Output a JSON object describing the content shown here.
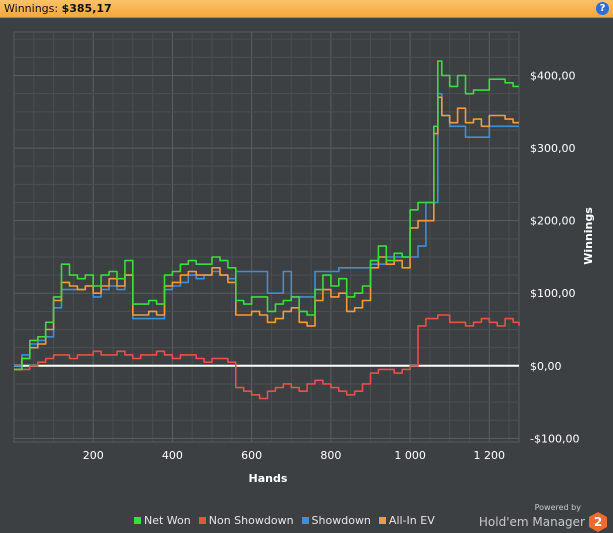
{
  "header": {
    "title_label": "Winnings:",
    "title_value": "$385,17",
    "help_icon": "?"
  },
  "branding": {
    "powered_by": "Powered by",
    "product": "Hold'em Manager",
    "logo_mark": "2"
  },
  "chart_data": {
    "type": "line",
    "xlabel": "Hands",
    "ylabel": "Winnings",
    "xlim": [
      0,
      1275
    ],
    "ylim": [
      -105,
      460
    ],
    "x_ticks": [
      200,
      400,
      600,
      800,
      1000,
      1200
    ],
    "x_tick_labels": [
      "200",
      "400",
      "600",
      "800",
      "1 000",
      "1 200"
    ],
    "y_ticks": [
      -100,
      0,
      100,
      200,
      300,
      400
    ],
    "y_tick_labels": [
      "-$100,00",
      "$0,00",
      "$100,00",
      "$200,00",
      "$300,00",
      "$400,00"
    ],
    "grid": true,
    "legend_position": "bottom",
    "series": [
      {
        "name": "Net Won",
        "color": "#3ddc3d",
        "x": [
          0,
          20,
          40,
          60,
          80,
          100,
          120,
          140,
          160,
          180,
          200,
          220,
          240,
          260,
          280,
          300,
          320,
          340,
          360,
          380,
          400,
          420,
          440,
          460,
          480,
          500,
          520,
          540,
          560,
          580,
          600,
          620,
          640,
          660,
          680,
          700,
          720,
          740,
          760,
          780,
          800,
          820,
          840,
          860,
          880,
          900,
          920,
          940,
          960,
          980,
          1000,
          1020,
          1040,
          1060,
          1070,
          1080,
          1100,
          1120,
          1140,
          1160,
          1180,
          1200,
          1220,
          1240,
          1260,
          1275
        ],
        "y": [
          -5,
          10,
          35,
          40,
          60,
          95,
          140,
          125,
          120,
          125,
          110,
          125,
          130,
          120,
          145,
          85,
          85,
          90,
          85,
          125,
          130,
          140,
          145,
          140,
          140,
          150,
          145,
          135,
          90,
          85,
          95,
          95,
          75,
          85,
          90,
          95,
          75,
          70,
          105,
          125,
          110,
          120,
          95,
          100,
          110,
          145,
          165,
          145,
          155,
          150,
          215,
          225,
          225,
          330,
          420,
          400,
          385,
          400,
          375,
          380,
          380,
          395,
          395,
          390,
          385,
          385
        ]
      },
      {
        "name": "Non Showdown",
        "color": "#e8504a",
        "x": [
          0,
          20,
          40,
          60,
          80,
          100,
          120,
          140,
          160,
          180,
          200,
          220,
          240,
          260,
          280,
          300,
          320,
          340,
          360,
          380,
          400,
          420,
          440,
          460,
          480,
          500,
          520,
          540,
          560,
          580,
          600,
          620,
          640,
          660,
          680,
          700,
          720,
          740,
          760,
          780,
          800,
          820,
          840,
          860,
          880,
          900,
          920,
          940,
          960,
          980,
          1000,
          1020,
          1040,
          1060,
          1070,
          1080,
          1100,
          1120,
          1140,
          1160,
          1180,
          1200,
          1220,
          1240,
          1260,
          1275
        ],
        "y": [
          -5,
          -5,
          0,
          5,
          10,
          15,
          15,
          10,
          15,
          15,
          20,
          15,
          15,
          20,
          15,
          10,
          15,
          15,
          20,
          15,
          10,
          15,
          15,
          10,
          5,
          10,
          10,
          5,
          -30,
          -35,
          -40,
          -45,
          -35,
          -30,
          -25,
          -30,
          -35,
          -25,
          -20,
          -25,
          -30,
          -35,
          -40,
          -35,
          -25,
          -10,
          -5,
          -5,
          -10,
          -5,
          0,
          55,
          65,
          65,
          70,
          70,
          60,
          60,
          55,
          60,
          65,
          60,
          55,
          65,
          60,
          55
        ]
      },
      {
        "name": "Showdown",
        "color": "#3f8fd6",
        "x": [
          0,
          20,
          40,
          60,
          80,
          100,
          120,
          140,
          160,
          180,
          200,
          220,
          240,
          260,
          280,
          300,
          320,
          340,
          360,
          380,
          400,
          420,
          440,
          460,
          480,
          500,
          520,
          540,
          560,
          580,
          600,
          620,
          640,
          660,
          680,
          700,
          720,
          740,
          760,
          780,
          800,
          820,
          840,
          860,
          880,
          900,
          920,
          940,
          960,
          980,
          1000,
          1020,
          1040,
          1060,
          1070,
          1080,
          1100,
          1120,
          1140,
          1160,
          1180,
          1200,
          1220,
          1240,
          1260,
          1275
        ],
        "y": [
          0,
          15,
          30,
          35,
          40,
          80,
          105,
          105,
          105,
          110,
          95,
          105,
          110,
          105,
          125,
          65,
          65,
          65,
          65,
          105,
          110,
          115,
          125,
          120,
          125,
          130,
          125,
          120,
          130,
          130,
          130,
          130,
          100,
          100,
          130,
          95,
          95,
          95,
          130,
          130,
          130,
          135,
          135,
          135,
          135,
          140,
          140,
          150,
          150,
          150,
          150,
          165,
          225,
          225,
          375,
          345,
          330,
          330,
          315,
          315,
          315,
          330,
          330,
          330,
          330,
          330
        ]
      },
      {
        "name": "All-In EV",
        "color": "#f39a3c",
        "x": [
          0,
          20,
          40,
          60,
          80,
          100,
          120,
          140,
          160,
          180,
          200,
          220,
          240,
          260,
          280,
          300,
          320,
          340,
          360,
          380,
          400,
          420,
          440,
          460,
          480,
          500,
          520,
          540,
          560,
          580,
          600,
          620,
          640,
          660,
          680,
          700,
          720,
          740,
          760,
          780,
          800,
          820,
          840,
          860,
          880,
          900,
          920,
          940,
          960,
          980,
          1000,
          1020,
          1040,
          1060,
          1070,
          1080,
          1100,
          1120,
          1140,
          1160,
          1180,
          1200,
          1220,
          1240,
          1260,
          1275
        ],
        "y": [
          -5,
          10,
          25,
          30,
          50,
          90,
          115,
          110,
          105,
          110,
          100,
          110,
          120,
          110,
          125,
          70,
          70,
          75,
          70,
          110,
          115,
          125,
          130,
          125,
          125,
          135,
          125,
          115,
          70,
          70,
          75,
          70,
          60,
          65,
          75,
          80,
          60,
          55,
          90,
          105,
          95,
          100,
          75,
          80,
          90,
          135,
          150,
          140,
          145,
          135,
          190,
          200,
          200,
          320,
          370,
          345,
          335,
          355,
          335,
          340,
          330,
          345,
          345,
          340,
          335,
          335
        ]
      }
    ]
  }
}
